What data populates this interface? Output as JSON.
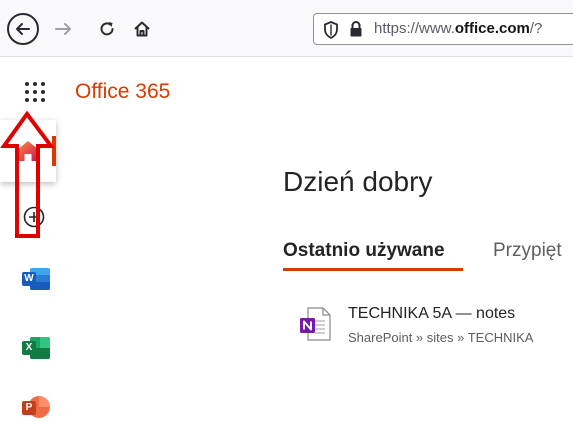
{
  "browser": {
    "url_prefix": "https://www.",
    "url_domain": "office.com",
    "url_suffix": "/?"
  },
  "header": {
    "brand": "Office 365"
  },
  "main": {
    "greeting": "Dzień dobry",
    "tabs": [
      {
        "label": "Ostatnio używane",
        "active": true
      },
      {
        "label": "Przypięt",
        "active": false
      }
    ],
    "files": [
      {
        "name": "TECHNIKA 5A — notes",
        "path": "SharePoint » sites » TECHNIKA",
        "icon": "onenote-icon"
      }
    ]
  },
  "rail": {
    "items": [
      "home-icon",
      "create-icon",
      "word-icon",
      "excel-icon",
      "powerpoint-icon"
    ],
    "word_letter": "W",
    "excel_letter": "X",
    "powerpoint_letter": "P"
  },
  "colors": {
    "brand": "#d83b01",
    "annotation": "#e00000",
    "word": "#185abd",
    "excel": "#107c41",
    "powerpoint": "#c43e1c",
    "onenote": "#7719aa"
  }
}
